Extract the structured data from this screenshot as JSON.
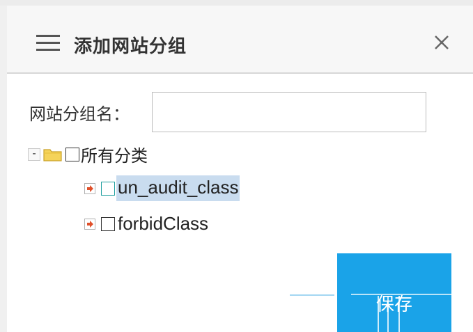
{
  "dialog": {
    "title": "添加网站分组",
    "menu_icon": "hamburger-menu-icon",
    "close_icon": "close-icon"
  },
  "form": {
    "group_name_label": "网站分组名：",
    "group_name_value": "",
    "group_name_placeholder": ""
  },
  "tree": {
    "root": {
      "toggle": "-",
      "icon": "folder-icon",
      "checked": false,
      "label": "所有分类"
    },
    "children": [
      {
        "label": "un_audit_class",
        "checked": false,
        "selected": true,
        "icon": "expand-arrow-icon"
      },
      {
        "label": "forbidClass",
        "checked": false,
        "selected": false,
        "icon": "expand-arrow-icon"
      }
    ]
  },
  "actions": {
    "save_label": "保存"
  },
  "colors": {
    "accent": "#1aa3e8",
    "selection": "#c9dcef",
    "header_bg": "#f7f7f7"
  }
}
